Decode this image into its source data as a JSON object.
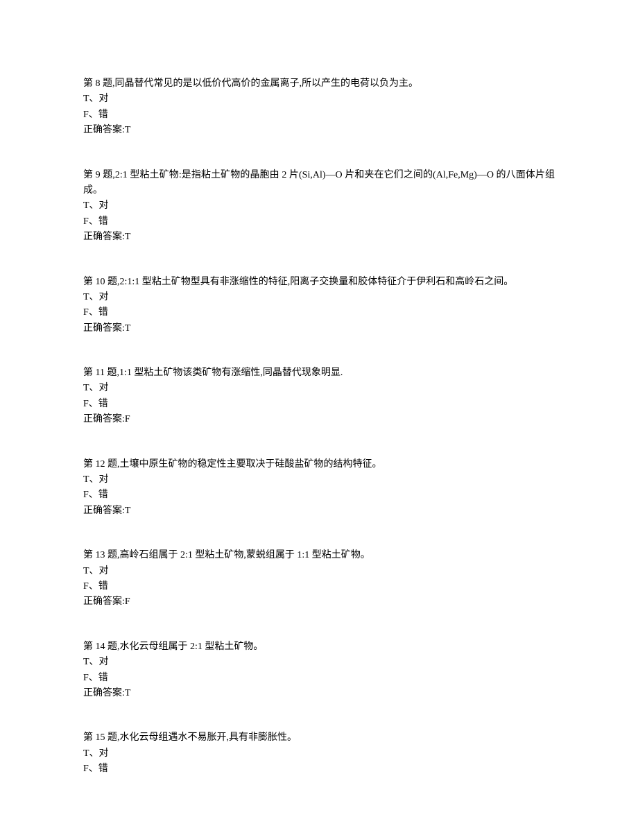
{
  "questions": [
    {
      "number": "第 8 题,",
      "text": "同晶替代常见的是以低价代高价的金属离子,所以产生的电荷以负为主。",
      "optionT": "T、对",
      "optionF": "F、错",
      "answerLabel": "正确答案:",
      "answerValue": "T"
    },
    {
      "number": "第 9 题,",
      "text": "2:1 型粘土矿物:是指粘土矿物的晶胞由 2 片(Si,Al)—O 片和夹在它们之间的(Al,Fe,Mg)—O 的八面体片组成。",
      "optionT": "T、对",
      "optionF": "F、错",
      "answerLabel": "正确答案:",
      "answerValue": "T"
    },
    {
      "number": "第 10 题,",
      "text": "2:1:1 型粘土矿物型具有非涨缩性的特征,阳离子交换量和胶体特征介于伊利石和高岭石之间。",
      "optionT": "T、对",
      "optionF": "F、错",
      "answerLabel": "正确答案:",
      "answerValue": "T"
    },
    {
      "number": "第 11 题,",
      "text": "1:1 型粘土矿物该类矿物有涨缩性,同晶替代现象明显.",
      "optionT": "T、对",
      "optionF": "F、错",
      "answerLabel": "正确答案:",
      "answerValue": "F"
    },
    {
      "number": "第 12 题,",
      "text": "土壤中原生矿物的稳定性主要取决于硅酸盐矿物的结构特征。",
      "optionT": "T、对",
      "optionF": "F、错",
      "answerLabel": "正确答案:",
      "answerValue": "T"
    },
    {
      "number": "第 13 题,",
      "text": "高岭石组属于 2:1 型粘土矿物,蒙蜕组属于 1:1 型粘土矿物。",
      "optionT": "T、对",
      "optionF": "F、错",
      "answerLabel": "正确答案:",
      "answerValue": "F"
    },
    {
      "number": "第 14 题,",
      "text": "水化云母组属于 2:1 型粘土矿物。",
      "optionT": "T、对",
      "optionF": "F、错",
      "answerLabel": "正确答案:",
      "answerValue": "T"
    },
    {
      "number": "第 15 题,",
      "text": "水化云母组遇水不易胀开,具有非膨胀性。",
      "optionT": "T、对",
      "optionF": "F、错",
      "answerLabel": "",
      "answerValue": ""
    }
  ]
}
